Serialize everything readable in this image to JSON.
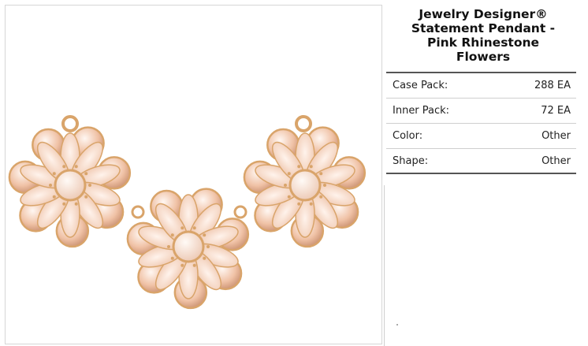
{
  "product": {
    "title_lines": [
      "Jewelry Designer®",
      "Statement Pendant -",
      "Pink Rhinestone",
      "Flowers"
    ],
    "image_subject": "three-pink-rhinestone-flowers-pendant"
  },
  "specs": [
    {
      "label": "Case Pack:",
      "value": "288 EA"
    },
    {
      "label": "Inner Pack:",
      "value": "72 EA"
    },
    {
      "label": "Color:",
      "value": "Other"
    },
    {
      "label": "Shape:",
      "value": "Other"
    }
  ],
  "colors": {
    "gold": "#d9a46a",
    "petal": "#f5dccd",
    "rhinestone": "#f2c7b0"
  }
}
